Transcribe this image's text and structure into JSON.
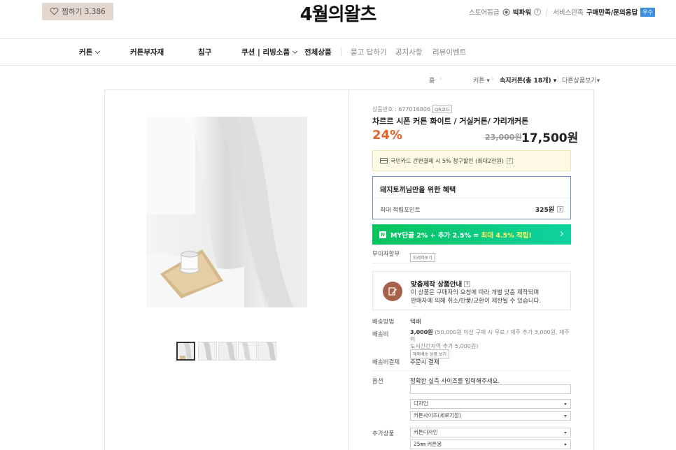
{
  "header": {
    "like_label": "찜하기 3,386",
    "brand": "4월의왈츠",
    "store_grade_label": "스토어등급",
    "grade": "빅파워",
    "grade_help": "?",
    "service_label": "서비스만족",
    "service_value": "구매만족/문의응답",
    "service_badge": "우수"
  },
  "nav": {
    "items": [
      {
        "label": "커튼"
      },
      {
        "label": "커튼부자재"
      },
      {
        "label": "침구"
      },
      {
        "label": "쿠션 | 리빙소품"
      },
      {
        "label": "전체상품"
      },
      {
        "label": "묻고 답하기"
      },
      {
        "label": "공지사항"
      },
      {
        "label": "리뷰이벤트"
      }
    ]
  },
  "breadcrumb": {
    "home": "홈",
    "cat1": "커튼",
    "cat2": "속지커튼(총 18개)",
    "more": "다른상품보기"
  },
  "product": {
    "id_label": "상품번호 : 677016806",
    "qr_label": "QR코드",
    "title": "차르르 시폰 커튼 화이트 / 거실커튼/ 가리개커튼",
    "discount_rate": "24%",
    "original_price": "23,000원",
    "sale_price": "17,500원",
    "card_offer": "국민카드 간편결제 시 5% 청구할인 (최대2천원)",
    "benefit_title": "돼지토끼님만을 위한 혜택",
    "benefit_label": "최대 적립포인트",
    "benefit_value": "325원",
    "membership_prefix": "MY단골 2% + 추가 2.5% =",
    "membership_highlight": "최대 4.5% 적립!",
    "n_logo": "N",
    "installment_label": "무이자할부",
    "installment_btn": "자세히보기",
    "custom_title": "맞춤제작 상품안내",
    "custom_line1": "이 상품은 구매자의 요청에 따라 개별 맞춤 제작되며",
    "custom_line2": "판매자에 의해 취소/반품/교환이 제한될 수 있습니다.",
    "ship_method_label": "배송방법",
    "ship_method": "택배",
    "ship_fee_label": "배송비",
    "ship_fee_amount": "3,000원",
    "ship_fee_note": "(50,000원 이상 구매 시 무료 / 제주 추가 3,000원, 제주 외",
    "ship_fee_note2": "도서산간지역 추가 5,000원)",
    "ship_fee_btn": "해외배송 상품 보기",
    "ship_pay_label": "배송비결제",
    "ship_pay": "주문시 결제",
    "option_label": "옵션",
    "option_note": "정확한 실측 사이즈를 입력해주세요.",
    "option_input_placeholder": "",
    "select_design": "디자인",
    "select_size": "커튼사이즈(세로기장)",
    "extra_label": "추가상품",
    "select_extra1": "커튼디자인",
    "select_extra2": "25㎜ 커튼봉"
  }
}
